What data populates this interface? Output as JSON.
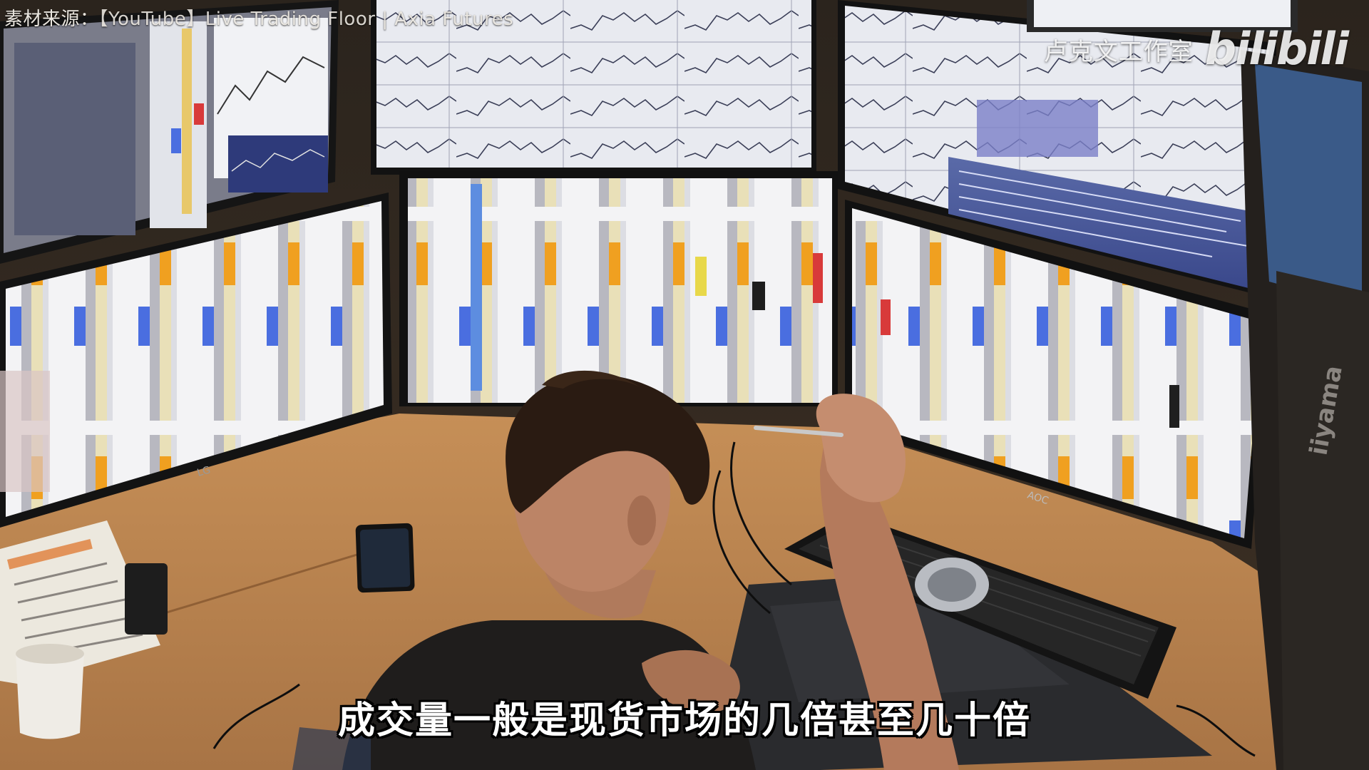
{
  "overlay": {
    "source_label": "素材来源：",
    "source_text": "【YouTube】Live Trading Floor | Axia Futures"
  },
  "watermark": {
    "studio": "卢克文工作室",
    "logo": "bilibili"
  },
  "subtitle": "成交量一般是现货市场的几倍甚至几十倍",
  "scene": {
    "monitor_brands": [
      "LG",
      "AOC",
      "iiyama"
    ],
    "accent_colors": {
      "ladder_blue": "#4a6ee0",
      "ladder_orange": "#f0a020",
      "ladder_red": "#d83a3a",
      "ladder_yellow": "#e8d84a",
      "desk_wood": "#c9925a"
    }
  }
}
